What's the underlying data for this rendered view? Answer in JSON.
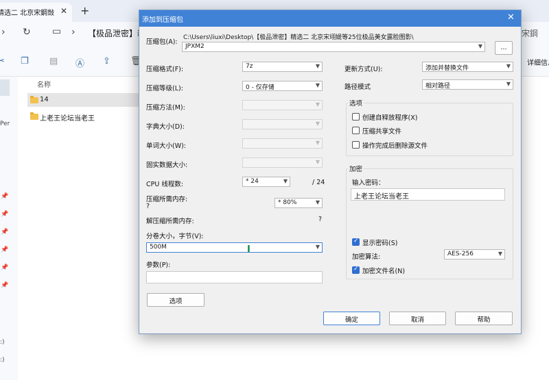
{
  "explorer": {
    "tab_title": "精选二 北京宋鋼敱",
    "address_text": "【极品泄密】新",
    "address_right": "宋鋼",
    "toolbar_right": "详细信息",
    "column_name": "名称",
    "left_texts": [
      "Per",
      ":)",
      ":)"
    ],
    "files": [
      {
        "name": "14"
      },
      {
        "name": "上老王论坛当老王"
      }
    ]
  },
  "dialog": {
    "title": "添加到压缩包",
    "archive_label": "压缩包(A):",
    "archive_path": "C:\\Users\\liuxi\\Desktop\\【极品泄密】精选二 北京宋翊媞等25位极品美女露脸图影\\",
    "archive_name": "JPXM2",
    "browse_label": "...",
    "left": {
      "format_label": "压缩格式(F):",
      "format_value": "7z",
      "level_label": "压缩等级(L):",
      "level_value": "0 - 仅存储",
      "method_label": "压缩方法(M):",
      "dict_label": "字典大小(D):",
      "word_label": "单词大小(W):",
      "solid_label": "固实数据大小:",
      "cpu_label": "CPU 线程数:",
      "cpu_value": "* 24",
      "cpu_total": "/ 24",
      "mem_label": "压缩所需内存:",
      "mem_value": "? ",
      "mem_combo": "* 80%",
      "decomp_label": "解压缩所需内存:",
      "decomp_value": "?",
      "volume_label": "分卷大小，字节(V):",
      "volume_value": "500M",
      "params_label": "参数(P):",
      "options_button": "选项"
    },
    "right": {
      "update_label": "更新方式(U):",
      "update_value": "添加并替换文件",
      "path_label": "路径模式",
      "path_value": "相对路径",
      "options_group": "选项",
      "opt_sfx": "创建自释放程序(X)",
      "opt_shared": "压缩共享文件",
      "opt_delete": "操作完成后删除源文件",
      "encrypt_group": "加密",
      "password_label": "输入密码：",
      "password_value": "上老王论坛当老王",
      "show_password": "显示密码(S)",
      "algo_label": "加密算法:",
      "algo_value": "AES-256",
      "encrypt_names": "加密文件名(N)"
    },
    "buttons": {
      "ok": "确定",
      "cancel": "取消",
      "help": "帮助"
    }
  }
}
